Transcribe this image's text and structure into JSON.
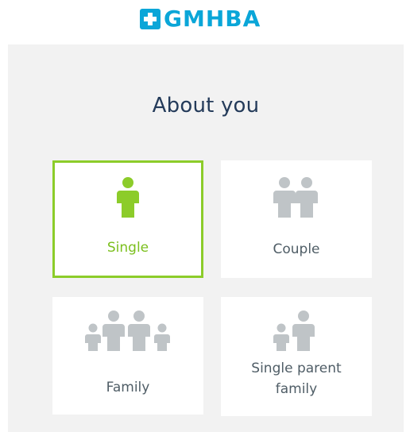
{
  "brand": {
    "name": "GMHBA",
    "color": "#0aa6d8"
  },
  "page": {
    "title": "About you"
  },
  "options": [
    {
      "label": "Single",
      "icon": "single-person-icon",
      "selected": true
    },
    {
      "label": "Couple",
      "icon": "couple-icon",
      "selected": false
    },
    {
      "label": "Family",
      "icon": "family-icon",
      "selected": false
    },
    {
      "label": "Single parent family",
      "label_line1": "Single parent",
      "label_line2": "family",
      "icon": "single-parent-icon",
      "selected": false
    }
  ],
  "colors": {
    "selected": "#8ccc2a",
    "icon_inactive": "#bfc4c7",
    "title": "#243b5a",
    "panel_bg": "#f2f2f2"
  }
}
